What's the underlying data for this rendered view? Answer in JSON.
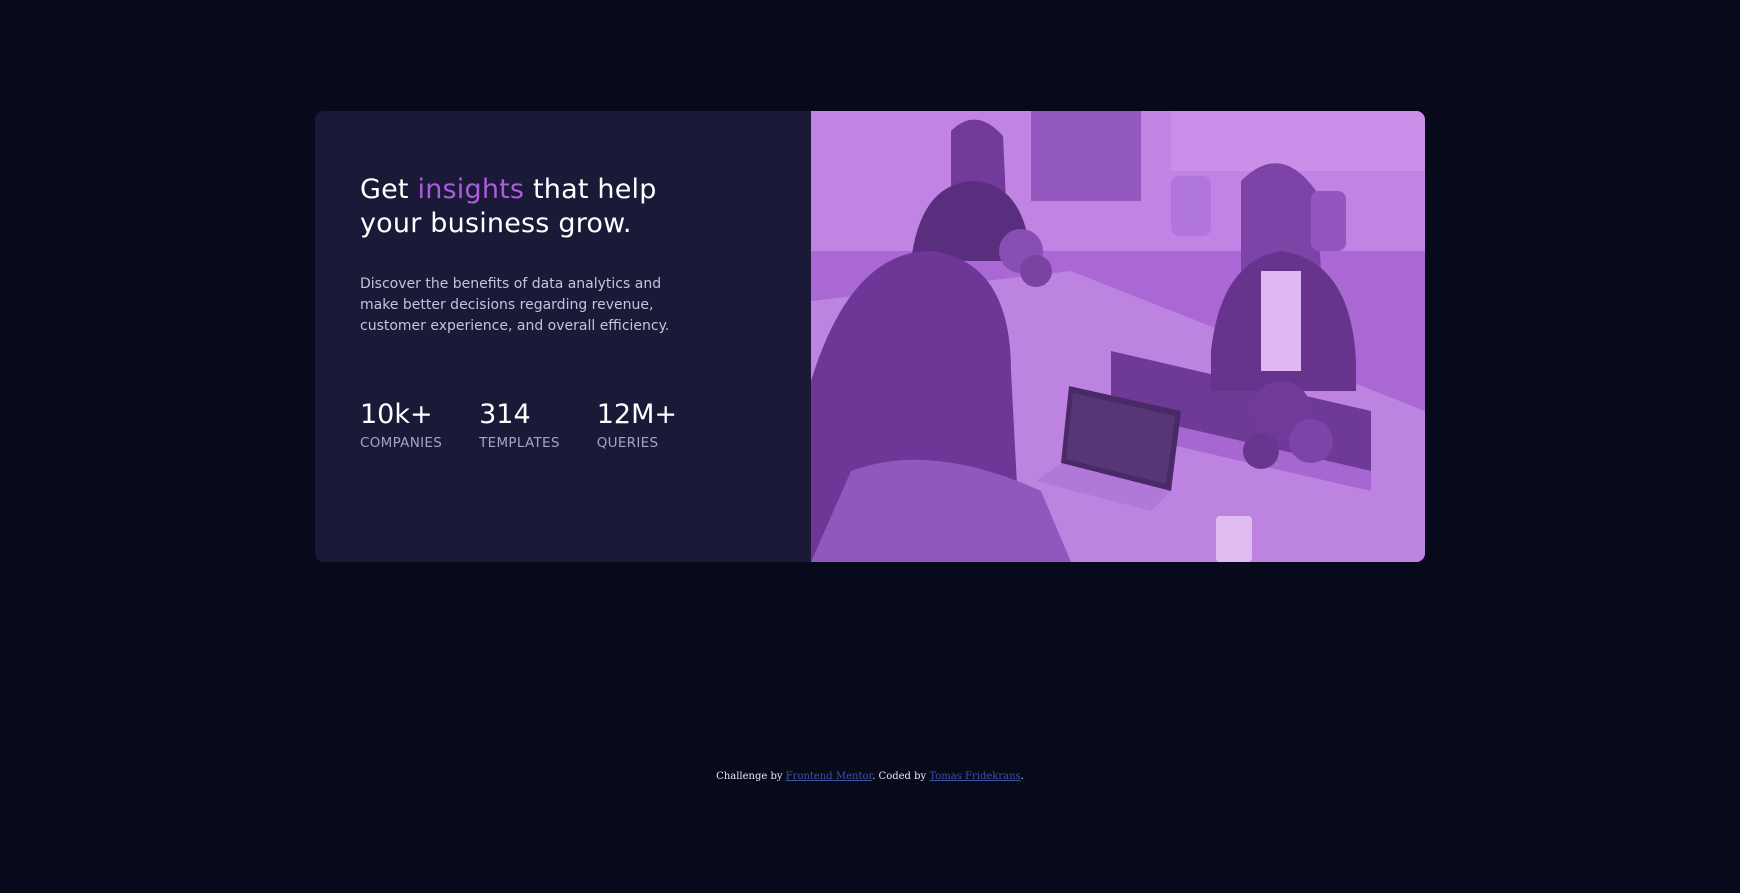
{
  "card": {
    "headline": {
      "before": "Get ",
      "accent": "insights",
      "after": " that help your business grow."
    },
    "description": "Discover the benefits of data analytics and make better decisions regarding revenue, customer experience, and overall efficiency.",
    "stats": [
      {
        "value": "10k+",
        "label": "COMPANIES"
      },
      {
        "value": "314",
        "label": "TEMPLATES"
      },
      {
        "value": "12M+",
        "label": "QUERIES"
      }
    ]
  },
  "footer": {
    "prefix": "Challenge by ",
    "link1": "Frontend Mentor",
    "middle": ". Coded by ",
    "link2": "Tomas Fridekrans",
    "suffix": "."
  },
  "colors": {
    "background": "#070a1a",
    "card": "#1b1938",
    "accent": "#ab5cdb",
    "image_overlay": "#aa5cdb"
  }
}
